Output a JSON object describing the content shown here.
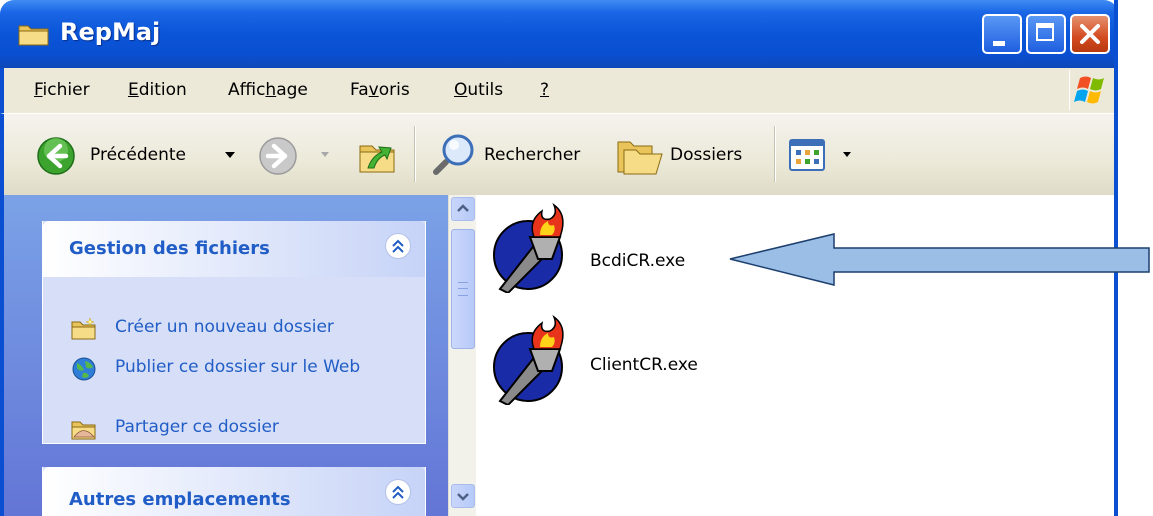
{
  "window": {
    "title": "RepMaj"
  },
  "menubar": {
    "items": [
      {
        "label": "Fichier",
        "accel": "F",
        "rest": "ichier"
      },
      {
        "label": "Edition",
        "accel": "E",
        "rest": "dition"
      },
      {
        "label": "Affichage",
        "pre": "Affic",
        "accel": "h",
        "rest": "age"
      },
      {
        "label": "Favoris",
        "pre": "Fa",
        "accel": "v",
        "rest": "oris"
      },
      {
        "label": "Outils",
        "accel": "O",
        "rest": "utils"
      },
      {
        "label": "?",
        "accel": "?",
        "rest": ""
      }
    ]
  },
  "toolbar": {
    "back_label": "Précédente",
    "search_label": "Rechercher",
    "folders_label": "Dossiers"
  },
  "taskpane": {
    "file_tasks": {
      "title": "Gestion des fichiers",
      "items": [
        {
          "label": "Créer un nouveau dossier"
        },
        {
          "label": "Publier ce dossier sur le Web"
        },
        {
          "label": "Partager ce dossier"
        }
      ]
    },
    "other_places": {
      "title": "Autres emplacements"
    }
  },
  "files": [
    {
      "name": "BcdiCR.exe"
    },
    {
      "name": "ClientCR.exe"
    }
  ],
  "colors": {
    "titlebar": "#0a55d8",
    "taskpane": "#6f8fdf",
    "task_text": "#215dc6",
    "arrow_fill": "#9bbee7",
    "arrow_stroke": "#1c3f6e"
  }
}
